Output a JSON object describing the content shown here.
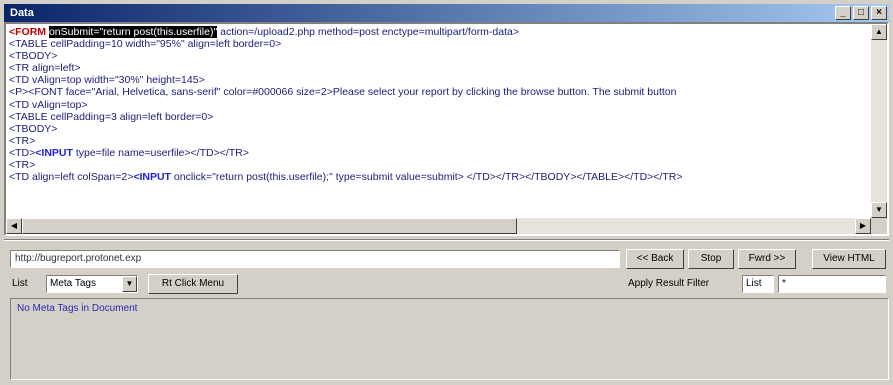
{
  "window": {
    "title": "Data",
    "controls": [
      "_",
      "□",
      "×"
    ]
  },
  "source": {
    "lines": [
      [
        {
          "t": "<FORM ",
          "c": "tok-form"
        },
        {
          "t": "onSubmit=\"return post(this.userfile)\"",
          "c": "tok-sel"
        },
        {
          "t": " action=/upload2.php method=post enctype=multipart/form-data>",
          "c": ""
        }
      ],
      [
        {
          "t": "<TABLE cellPadding=10 width=\"95%\" align=left border=0>",
          "c": ""
        }
      ],
      [
        {
          "t": "<TBODY>",
          "c": ""
        }
      ],
      [
        {
          "t": "<TR align=left>",
          "c": ""
        }
      ],
      [
        {
          "t": "<TD vAlign=top width=\"30%\" height=145>",
          "c": ""
        }
      ],
      [
        {
          "t": "<P><FONT face=\"Arial, Helvetica, sans-serif\" color=#000066 size=2>Please select your report by clicking the browse button. The submit button",
          "c": ""
        }
      ],
      [
        {
          "t": "<TD vAlign=top>",
          "c": ""
        }
      ],
      [
        {
          "t": "<TABLE cellPadding=3 align=left border=0>",
          "c": ""
        }
      ],
      [
        {
          "t": "<TBODY>",
          "c": ""
        }
      ],
      [
        {
          "t": "<TR>",
          "c": ""
        }
      ],
      [
        {
          "t": "<TD>",
          "c": ""
        },
        {
          "t": "<INPUT",
          "c": "tok-input"
        },
        {
          "t": " type=file name=userfile></TD></TR>",
          "c": ""
        }
      ],
      [
        {
          "t": "<TR>",
          "c": ""
        }
      ],
      [
        {
          "t": "<TD align=left colSpan=2>",
          "c": ""
        },
        {
          "t": "<INPUT",
          "c": "tok-input"
        },
        {
          "t": " onclick=\"return post(this.userfile);\" type=submit value=submit> </TD></TR></TBODY></TABLE></TD></TR>",
          "c": ""
        }
      ]
    ]
  },
  "toolbar": {
    "url": "http://bugreport.protonet.exp",
    "back_label": "<< Back",
    "stop_label": "Stop",
    "fwd_label": "Fwrd >>",
    "view_html_label": "View HTML"
  },
  "options": {
    "list_label": "List",
    "list_value": "Meta Tags",
    "rclick_label": "Rt Click Menu",
    "filter_label": "Apply Result Filter",
    "filter_value_1": "List",
    "filter_value_2": "*"
  },
  "results": {
    "text": "No Meta Tags in Document"
  }
}
